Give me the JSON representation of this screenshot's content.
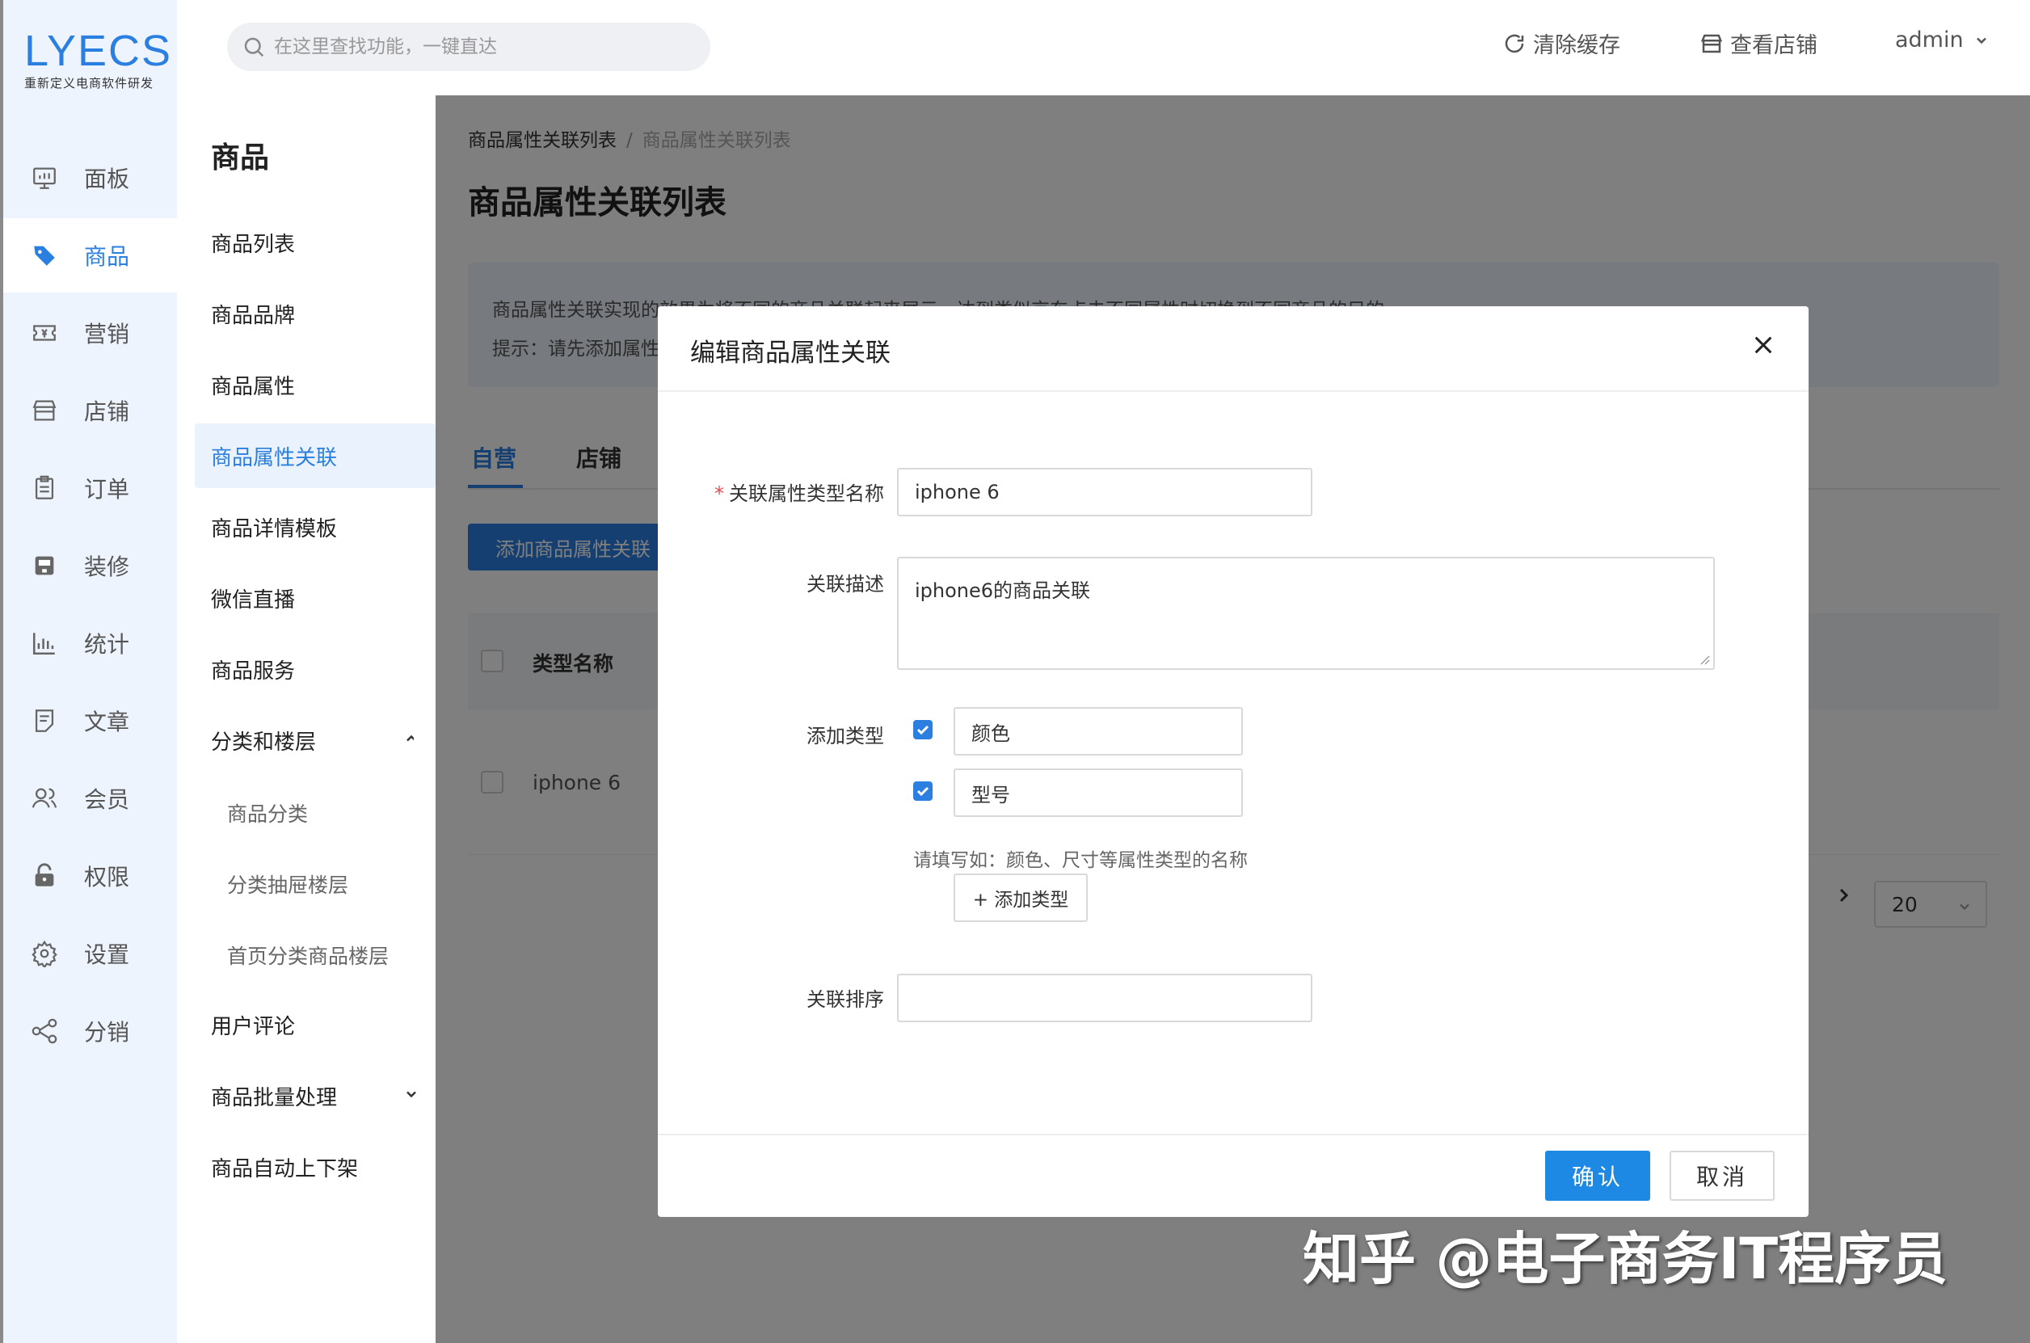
{
  "logo": {
    "mark": "LYECS",
    "tagline": "重新定义电商软件研发"
  },
  "rail": [
    {
      "label": "面板",
      "icon": "dashboard-icon"
    },
    {
      "label": "商品",
      "icon": "tag-icon",
      "active": true
    },
    {
      "label": "营销",
      "icon": "ticket-icon"
    },
    {
      "label": "店铺",
      "icon": "store-icon"
    },
    {
      "label": "订单",
      "icon": "clipboard-icon"
    },
    {
      "label": "装修",
      "icon": "decorate-icon"
    },
    {
      "label": "统计",
      "icon": "bar-chart-icon"
    },
    {
      "label": "文章",
      "icon": "article-icon"
    },
    {
      "label": "会员",
      "icon": "users-icon"
    },
    {
      "label": "权限",
      "icon": "lock-icon"
    },
    {
      "label": "设置",
      "icon": "gear-icon"
    },
    {
      "label": "分销",
      "icon": "share-icon"
    }
  ],
  "submenu": {
    "title": "商品",
    "items": [
      {
        "label": "商品列表"
      },
      {
        "label": "商品品牌"
      },
      {
        "label": "商品属性"
      },
      {
        "label": "商品属性关联",
        "active": true
      },
      {
        "label": "商品详情模板"
      },
      {
        "label": "微信直播"
      },
      {
        "label": "商品服务"
      },
      {
        "label": "分类和楼层",
        "expanded": true
      },
      {
        "label": "商品分类",
        "child": true
      },
      {
        "label": "分类抽屉楼层",
        "child": true
      },
      {
        "label": "首页分类商品楼层",
        "child": true
      },
      {
        "label": "用户评论"
      },
      {
        "label": "商品批量处理",
        "collapsible": true
      },
      {
        "label": "商品自动上下架"
      }
    ]
  },
  "header": {
    "search_placeholder": "在这里查找功能，一键直达",
    "clear_cache": "清除缓存",
    "view_store": "查看店铺",
    "user": "admin"
  },
  "main": {
    "breadcrumb": [
      "商品属性关联列表",
      "商品属性关联列表"
    ],
    "title": "商品属性关联列表",
    "notice_line1": "商品属性关联实现的效果为将不同的商品关联起来展示，达到类似京东点击不同属性时切换到不同商品的目的",
    "notice_line2": "提示：请先添加属性",
    "tabs": [
      "自营",
      "店铺"
    ],
    "add_button": "添加商品属性关联",
    "table_header": "类型名称",
    "rows": [
      "iphone 6"
    ],
    "page_size": "20"
  },
  "dialog": {
    "title": "编辑商品属性关联",
    "fields": {
      "type_name_label": "关联属性类型名称",
      "type_name_value": "iphone 6",
      "desc_label": "关联描述",
      "desc_value": "iphone6的商品关联",
      "add_type_label": "添加类型",
      "types": [
        "颜色",
        "型号"
      ],
      "hint": "请填写如：颜色、尺寸等属性类型的名称",
      "add_type_button": "+ 添加类型",
      "sort_label": "关联排序",
      "sort_value": ""
    },
    "confirm": "确认",
    "cancel": "取消"
  },
  "watermark": "知乎 @电子商务IT程序员",
  "colors": {
    "accent": "#2b7fe0",
    "confirm": "#1e88e5",
    "required": "#e34d4d"
  }
}
